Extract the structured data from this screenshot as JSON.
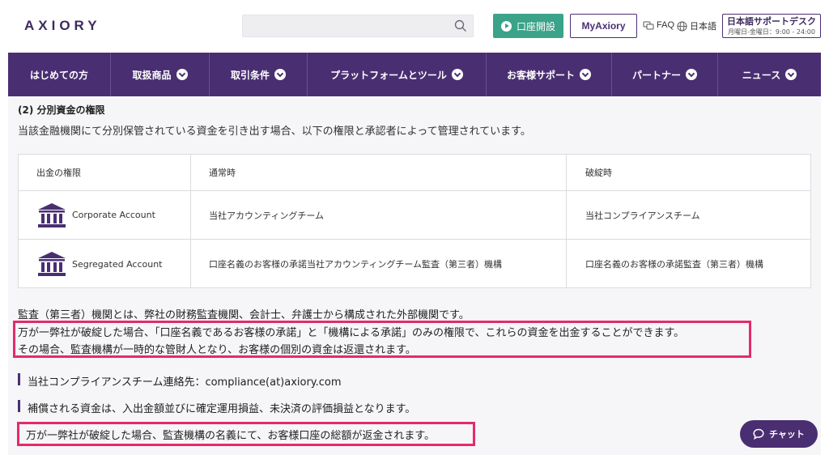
{
  "header": {
    "logo": "AXIORY",
    "search": {
      "placeholder": ""
    },
    "open_account": "口座開設",
    "my_axiory": "MyAxiory",
    "faq": "FAQ",
    "language": "日本語",
    "support": {
      "title": "日本語サポートデスク",
      "hours": "月曜日-金曜日：9:00 - 24:00"
    }
  },
  "nav": {
    "items": [
      {
        "label": "はじめての方",
        "dropdown": false
      },
      {
        "label": "取扱商品",
        "dropdown": true
      },
      {
        "label": "取引条件",
        "dropdown": true
      },
      {
        "label": "プラットフォームとツール",
        "dropdown": true
      },
      {
        "label": "お客様サポート",
        "dropdown": true
      },
      {
        "label": "パートナー",
        "dropdown": true
      },
      {
        "label": "ニュース",
        "dropdown": true
      }
    ]
  },
  "content": {
    "heading": "(2) 分別資金の権限",
    "intro": "当該金融機関にて分別保管されている資金を引き出す場合、以下の権限と承認者によって管理されています。",
    "table": {
      "headers": [
        "出金の権限",
        "通常時",
        "破綻時"
      ],
      "rows": [
        {
          "account": "Corporate Account",
          "normal": "当社アカウンティングチーム",
          "bankruptcy": "当社コンプライアンスチーム"
        },
        {
          "account": "Segregated Account",
          "normal": "口座名義のお客様の承諾当社アカウンティングチーム監査（第三者）機構",
          "bankruptcy": "口座名義のお客様の承諾監査（第三者）機構"
        }
      ]
    },
    "audit_note": "監査（第三者）機関とは、弊社の財務監査機関、会計士、弁護士から構成された外部機関です。",
    "highlight_line1": "万が一弊社が破綻した場合、「口座名義であるお客様の承諾」と「機構による承諾」のみの権限で、これらの資金を出金することができます。",
    "highlight_line2": "その場合、監査機構が一時的な管財人となり、お客様の個別の資金は返還されます。",
    "compliance_contact": "当社コンプライアンスチーム連絡先：compliance(at)axiory.com",
    "compensation": "補償される資金は、入出金額並びに確定運用損益、未決済の評価損益となります。",
    "final_note": "万が一弊社が破綻した場合、監査機構の名義にて、お客様口座の総額が返金されます。"
  },
  "chat": {
    "label": "チャット"
  },
  "colors": {
    "brand": "#4a2e72",
    "accent_green": "#3aa38a",
    "highlight": "#e52a6a"
  }
}
